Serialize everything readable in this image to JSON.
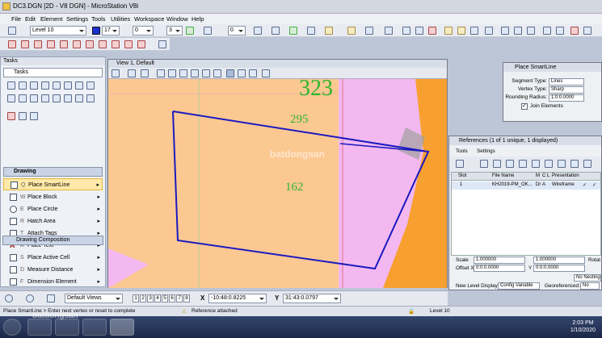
{
  "window": {
    "title": "DC3.DGN [2D - V8 DGN] - MicroStation V8i"
  },
  "menu": [
    "File",
    "Edit",
    "Element",
    "Settings",
    "Tools",
    "Utilities",
    "Workspace",
    "Window",
    "Help"
  ],
  "attributes": {
    "level": "Level 10",
    "color": "17",
    "weight": "3",
    "style": "0",
    "other": "0"
  },
  "tasks": {
    "header": "Tasks",
    "selector": "Tasks",
    "section": "Drawing",
    "tools": [
      {
        "key": "Q",
        "label": "Place SmartLine"
      },
      {
        "key": "W",
        "label": "Place Block"
      },
      {
        "key": "E",
        "label": "Place Circle"
      },
      {
        "key": "R",
        "label": "Hatch Area"
      },
      {
        "key": "T",
        "label": "Attach Tags"
      },
      {
        "key": "A",
        "label": "Place Text"
      },
      {
        "key": "S",
        "label": "Place Active Cell"
      },
      {
        "key": "D",
        "label": "Measure Distance"
      },
      {
        "key": "F",
        "label": "Dimension Element"
      }
    ],
    "footer": "Drawing Composition"
  },
  "view": {
    "title": "View 1, Default",
    "labels": {
      "parcel_main": "323",
      "parcel_a": "295",
      "parcel_b": "162"
    },
    "watermark": "batdongsan",
    "colors": {
      "parcel": "#fcc892",
      "pink": "#f3b8f0",
      "orange": "#f7a030",
      "line": "#1a1ac0",
      "text": "#2bb52b"
    }
  },
  "smartline": {
    "title": "Place SmartLine",
    "segment_type_label": "Segment Type:",
    "segment_type": "Lines",
    "vertex_type_label": "Vertex Type:",
    "vertex_type": "Sharp",
    "rounding_label": "Rounding Radius:",
    "rounding": "1:0:0.0000",
    "join_label": "Join Elements"
  },
  "references": {
    "title": "References (1 of 1 unique, 1 displayed)",
    "menu": [
      "Tools",
      "Settings"
    ],
    "columns": [
      "Slot",
      "",
      "File Name",
      "M",
      "C",
      "L",
      "Presentation",
      "",
      ""
    ],
    "rows": [
      [
        "1",
        "",
        "KH2019-PM_OK...",
        "Dr",
        "A",
        "",
        "Wireframe",
        "✓",
        "✓"
      ]
    ],
    "scale_label": "Scale",
    "scale_a": "1.000000",
    "scale_b": "1.000000",
    "rotation_label": "Rotat",
    "offset_x_label": "Offset X",
    "offset_x": "0:0:0.0000",
    "offset_y_label": "Y",
    "offset_y": "0:0:0.0000",
    "nesting": "No Nesting",
    "new_level_label": "New Level Display:",
    "new_level": "Config Variable",
    "georef_label": "Georeferenced:",
    "georef": "No"
  },
  "bottom": {
    "views_combo": "Default Views",
    "view_buttons": [
      "1",
      "2",
      "3",
      "4",
      "5",
      "6",
      "7",
      "8"
    ],
    "x_label": "X",
    "x_value": "-10:48:0.8225",
    "y_label": "Y",
    "y_value": "31:43:0.0797"
  },
  "status": {
    "prompt": "Place SmartLine > Enter next vertex or reset to complete",
    "message": "Reference attached",
    "level": "Level 10"
  },
  "taskbar": {
    "time": "2:03 PM",
    "date": "1/10/2020",
    "watermark": "batdongsan"
  }
}
